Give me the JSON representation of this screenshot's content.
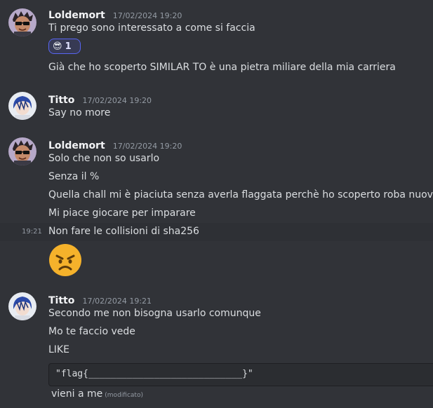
{
  "messages": [
    {
      "author": "Loldemort",
      "timestamp": "17/02/2024 19:20",
      "lines": [
        "Ti prego sono interessato a come si faccia",
        "Già che ho scoperto SIMILAR TO è una pietra miliare della mia carriera"
      ],
      "reaction": {
        "emoji": "😎",
        "count": "1"
      }
    },
    {
      "author": "Titto",
      "timestamp": "17/02/2024 19:20",
      "lines": [
        "Say no more"
      ]
    },
    {
      "author": "Loldemort",
      "timestamp": "17/02/2024 19:20",
      "lines": [
        "Solo che non so usarlo",
        "Senza il %",
        "Quella chall mi è piaciuta senza averla flaggata perchè ho scoperto roba nuova",
        "Mi piace giocare per imparare",
        "Non fare le collisioni di sha256"
      ],
      "hover_time": "19:21",
      "big_emoji": "angry-face"
    },
    {
      "author": "Titto",
      "timestamp": "17/02/2024 19:21",
      "lines": [
        "Secondo me non bisogna usarlo comunque",
        "Mo te faccio vede",
        "LIKE",
        "vieni a me"
      ],
      "code": "\"flag{____________________________}\"",
      "edited_label": "(modificato)"
    }
  ],
  "colors": {
    "background": "#313338",
    "text": "#dbdee1",
    "muted": "#949ba4",
    "accent": "#5865f2"
  }
}
